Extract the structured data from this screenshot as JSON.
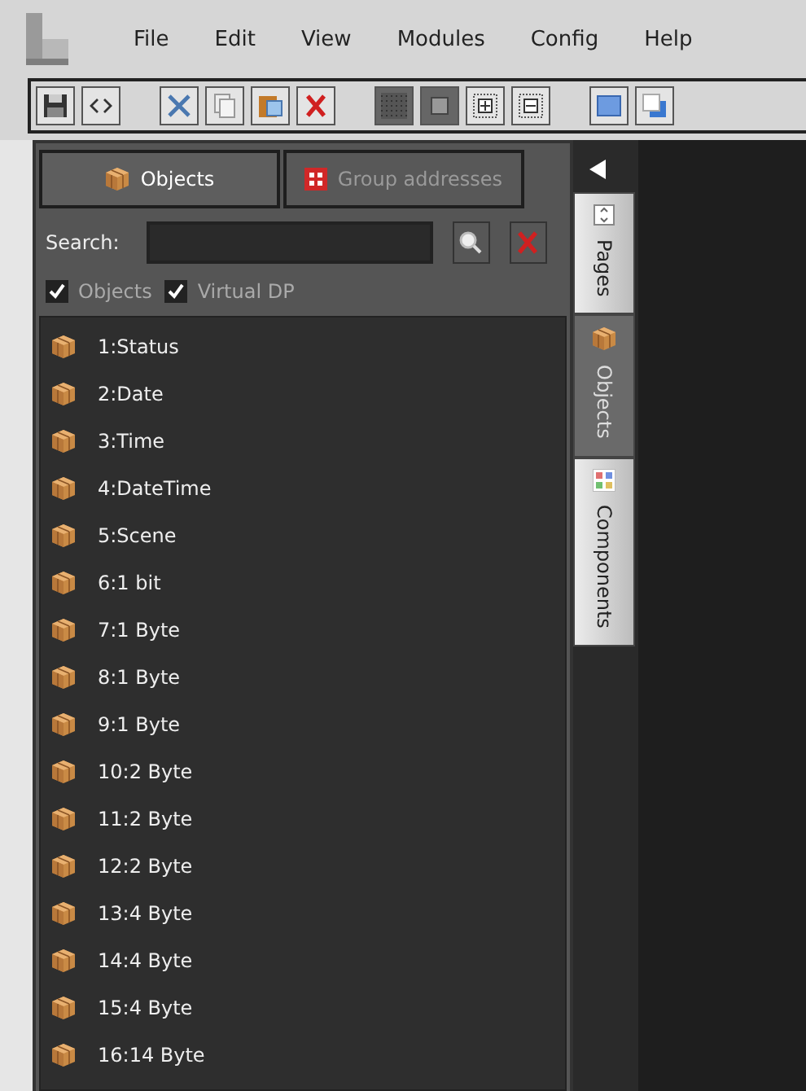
{
  "menu": [
    "File",
    "Edit",
    "View",
    "Modules",
    "Config",
    "Help"
  ],
  "panel_tabs": [
    {
      "label": "Objects",
      "kind": "objects",
      "selected": true
    },
    {
      "label": "Group addresses",
      "kind": "groups",
      "selected": false
    }
  ],
  "search": {
    "label": "Search:"
  },
  "filters": [
    {
      "label": "Objects",
      "checked": true
    },
    {
      "label": "Virtual DP",
      "checked": true
    }
  ],
  "objects": [
    "1:Status",
    "2:Date",
    "3:Time",
    "4:DateTime",
    "5:Scene",
    "6:1 bit",
    "7:1 Byte",
    "8:1 Byte",
    "9:1 Byte",
    "10:2 Byte",
    "11:2 Byte",
    "12:2 Byte",
    "13:4 Byte",
    "14:4 Byte",
    "15:4 Byte",
    "16:14 Byte"
  ],
  "side_tabs": [
    {
      "label": "Pages",
      "kind": "pages",
      "selected": false
    },
    {
      "label": "Objects",
      "kind": "objects",
      "selected": true
    },
    {
      "label": "Components",
      "kind": "components",
      "selected": false
    }
  ]
}
